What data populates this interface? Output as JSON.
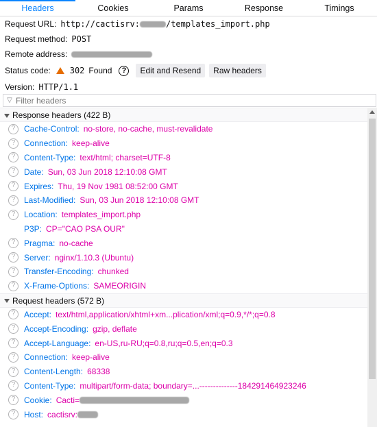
{
  "tabs": [
    "Headers",
    "Cookies",
    "Params",
    "Response",
    "Timings"
  ],
  "summary": {
    "request_url_label": "Request URL:",
    "request_url_prefix": "http://cactisrv:",
    "request_url_suffix": "/templates_import.php",
    "request_method_label": "Request method:",
    "request_method": "POST",
    "remote_address_label": "Remote address:",
    "status_code_label": "Status code:",
    "status_code": "302",
    "status_text": "Found",
    "help_glyph": "?",
    "edit_resend": "Edit and Resend",
    "raw_headers": "Raw headers",
    "version_label": "Version:",
    "version": "HTTP/1.1"
  },
  "filter": {
    "placeholder": "Filter headers"
  },
  "response_section": "Response headers (422 B)",
  "response_headers": [
    {
      "k": "Cache-Control:",
      "v": "no-store, no-cache, must-revalidate"
    },
    {
      "k": "Connection:",
      "v": "keep-alive"
    },
    {
      "k": "Content-Type:",
      "v": "text/html; charset=UTF-8"
    },
    {
      "k": "Date:",
      "v": "Sun, 03 Jun 2018 12:10:08 GMT"
    },
    {
      "k": "Expires:",
      "v": "Thu, 19 Nov 1981 08:52:00 GMT"
    },
    {
      "k": "Last-Modified:",
      "v": "Sun, 03 Jun 2018 12:10:08 GMT"
    },
    {
      "k": "Location:",
      "v": "templates_import.php"
    },
    {
      "k": "P3P:",
      "v": "CP=\"CAO PSA OUR\""
    },
    {
      "k": "Pragma:",
      "v": "no-cache"
    },
    {
      "k": "Server:",
      "v": "nginx/1.10.3 (Ubuntu)"
    },
    {
      "k": "Transfer-Encoding:",
      "v": "chunked"
    },
    {
      "k": "X-Frame-Options:",
      "v": "SAMEORIGIN"
    }
  ],
  "request_section": "Request headers (572 B)",
  "request_headers": [
    {
      "k": "Accept:",
      "v": "text/html,application/xhtml+xm...plication/xml;q=0.9,*/*;q=0.8"
    },
    {
      "k": "Accept-Encoding:",
      "v": "gzip, deflate"
    },
    {
      "k": "Accept-Language:",
      "v": "en-US,ru-RU;q=0.8,ru;q=0.5,en;q=0.3"
    },
    {
      "k": "Connection:",
      "v": "keep-alive"
    },
    {
      "k": "Content-Length:",
      "v": "68338"
    },
    {
      "k": "Content-Type:",
      "v": "multipart/form-data; boundary=...--------------184291464923246"
    },
    {
      "k": "Cookie:",
      "v": "Cacti="
    },
    {
      "k": "Host:",
      "v": "cactisrv:"
    }
  ],
  "colors": {
    "accent": "#0a84ff",
    "header_name": "#0074e8",
    "header_value": "#dd00a9",
    "warning": "#e66d00"
  },
  "icons": {
    "status": "warning-triangle-icon",
    "help": "help-circle-icon",
    "info": "info-circle-icon",
    "filter": "filter-icon"
  }
}
